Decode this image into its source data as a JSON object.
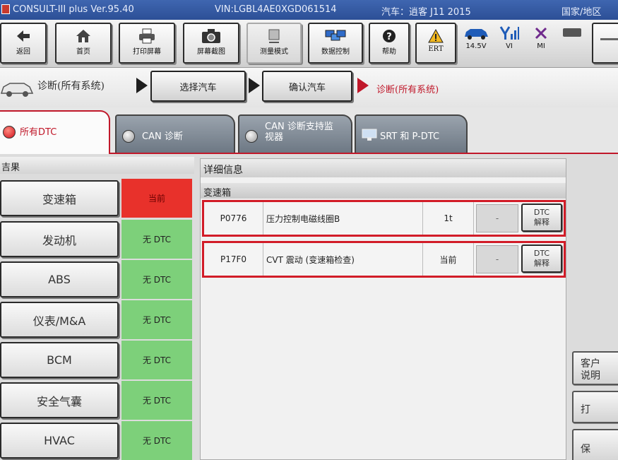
{
  "window": {
    "app_title": "CONSULT-III plus  Ver.95.40",
    "vin": "VIN:LGBL4AE0XGD061514",
    "vehicle": "汽车：逍客 J11 2015",
    "region": "国家/地区"
  },
  "toolbar": {
    "back_label": "返回",
    "home_label": "首页",
    "print_label": "打印屏幕",
    "screenshot_label": "屏幕截图",
    "measure_label": "测量模式",
    "data_control_label": "数据控制",
    "help_label": "帮助",
    "ert_label": "ERT",
    "battery_label": "14.5V",
    "vi_label": "VI",
    "mi_label": "MI"
  },
  "breadcrumb": {
    "home_label": "诊断(所有系统)",
    "step1": "选择汽车",
    "step2": "确认汽车",
    "current": "诊断(所有系统)"
  },
  "tabs": [
    {
      "label": "所有DTC"
    },
    {
      "label": "CAN 诊断"
    },
    {
      "label": "CAN 诊断支持监视器",
      "line1": "CAN 诊断支持监",
      "line2": "视器"
    },
    {
      "label": "SRT 和 P-DTC"
    }
  ],
  "results": {
    "header": "结果",
    "header_visible": "吉果",
    "systems": [
      {
        "name": "变速箱",
        "status": "当前",
        "status_color": "#e8312b"
      },
      {
        "name": "发动机",
        "status": "无 DTC",
        "status_color": "#7dd07a"
      },
      {
        "name": "ABS",
        "status": "无 DTC",
        "status_color": "#7dd07a"
      },
      {
        "name": "仪表/M&A",
        "status": "无 DTC",
        "status_color": "#7dd07a"
      },
      {
        "name": "BCM",
        "status": "无 DTC",
        "status_color": "#7dd07a"
      },
      {
        "name": "安全气囊",
        "status": "无 DTC",
        "status_color": "#7dd07a"
      },
      {
        "name": "HVAC",
        "status": "无 DTC",
        "status_color": "#7dd07a"
      }
    ]
  },
  "detail": {
    "header": "详细信息",
    "system": "变速箱",
    "dtcs": [
      {
        "code": "P0776",
        "description": "压力控制电磁线圈B",
        "status": "1t",
        "dash": "-",
        "button_line1": "DTC",
        "button_line2": "解释"
      },
      {
        "code": "P17F0",
        "description": "CVT 震动 (变速箱检查)",
        "status": "当前",
        "dash": "-",
        "button_line1": "DTC",
        "button_line2": "解释"
      }
    ]
  },
  "side": {
    "customer_line1": "客户",
    "customer_line2": "说明",
    "print": "打",
    "save": "保"
  },
  "colors": {
    "accent_red": "#c0182a",
    "status_current": "#e8312b",
    "status_no_dtc": "#7dd07a",
    "titlebar": "#2c4f96"
  }
}
